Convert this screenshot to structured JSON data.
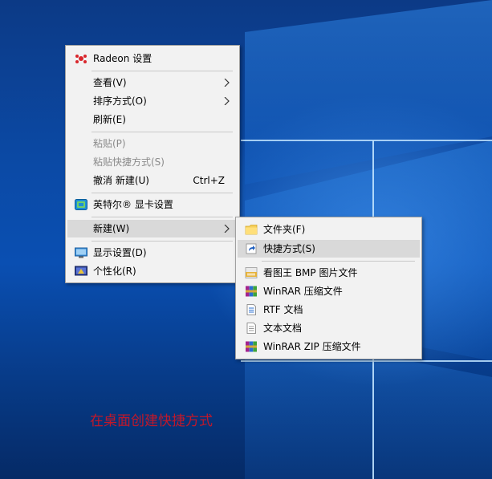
{
  "context_menu": {
    "items": [
      {
        "label": "Radeon 设置",
        "icon": "radeon-icon"
      },
      {
        "label": "查看(V)",
        "has_submenu": true
      },
      {
        "label": "排序方式(O)",
        "has_submenu": true
      },
      {
        "label": "刷新(E)"
      },
      {
        "label": "粘贴(P)",
        "disabled": true
      },
      {
        "label": "粘贴快捷方式(S)",
        "disabled": true
      },
      {
        "label": "撤消 新建(U)",
        "shortcut": "Ctrl+Z"
      },
      {
        "label": "英特尔® 显卡设置",
        "icon": "intel-graphics-icon"
      },
      {
        "label": "新建(W)",
        "has_submenu": true,
        "highlighted": true
      },
      {
        "label": "显示设置(D)",
        "icon": "display-settings-icon"
      },
      {
        "label": "个性化(R)",
        "icon": "personalize-icon"
      }
    ]
  },
  "new_submenu": {
    "items": [
      {
        "label": "文件夹(F)",
        "icon": "folder-icon"
      },
      {
        "label": "快捷方式(S)",
        "icon": "shortcut-icon",
        "highlighted": true
      },
      {
        "label": "看图王 BMP 图片文件",
        "icon": "bmp-file-icon"
      },
      {
        "label": "WinRAR 压缩文件",
        "icon": "winrar-icon"
      },
      {
        "label": "RTF 文档",
        "icon": "rtf-document-icon"
      },
      {
        "label": "文本文档",
        "icon": "text-document-icon"
      },
      {
        "label": "WinRAR ZIP 压缩文件",
        "icon": "winrar-zip-icon"
      }
    ]
  },
  "caption": "在桌面创建快捷方式",
  "colors": {
    "menu_bg": "#f2f2f2",
    "highlight": "#d9d9d9",
    "disabled_text": "#8a8a8a",
    "caption": "#c0182a"
  }
}
